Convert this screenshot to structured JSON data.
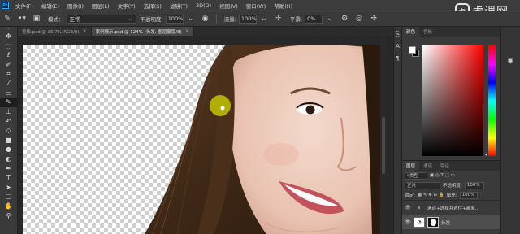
{
  "menubar": {
    "app_logo": "Ps",
    "items": [
      "文件(F)",
      "编辑(E)",
      "图像(I)",
      "图层(L)",
      "文字(Y)",
      "选择(S)",
      "滤镜(T)",
      "3D(D)",
      "视图(V)",
      "窗口(W)",
      "帮助(H)"
    ],
    "watermark": "虎课网"
  },
  "options": {
    "mode_label": "模式：",
    "mode_value": "正常",
    "opacity_label": "不透明度:",
    "opacity_value": "100%",
    "flow_label": "流量:",
    "flow_value": "100%",
    "smoothing_label": "平滑:",
    "smoothing_value": "0%"
  },
  "tabs": [
    {
      "title": "抠像.psd @ 36.7%(RGB/8)",
      "active": false
    },
    {
      "title": "案例展示.psd @ 124% (头发, 图层蒙版/8)",
      "active": true
    }
  ],
  "color_panel": {
    "tabs": [
      "颜色",
      "色板"
    ],
    "colors": {
      "foreground": "#ffffff",
      "background": "#000000"
    }
  },
  "layers_panel": {
    "tabs": [
      "图层",
      "通道",
      "路径"
    ],
    "filter_value": "类型",
    "blend_mode": "正常",
    "opacity_label": "不透明度:",
    "opacity_value": "100%",
    "lock_label": "锁定:",
    "fill_label": "填充:",
    "fill_value": "100%",
    "layers": [
      {
        "name": "通道+选择并遮住+画笔...",
        "type": "text"
      },
      {
        "name": "头发",
        "type": "image-with-mask"
      }
    ]
  },
  "tools": [
    "move-tool-icon",
    "marquee-tool-icon",
    "lasso-tool-icon",
    "quick-select-tool-icon",
    "crop-tool-icon",
    "eyedropper-tool-icon",
    "healing-tool-icon",
    "brush-tool-icon",
    "stamp-tool-icon",
    "history-brush-tool-icon",
    "eraser-tool-icon",
    "gradient-tool-icon",
    "blur-tool-icon",
    "dodge-tool-icon",
    "pen-tool-icon",
    "type-tool-icon",
    "path-select-tool-icon",
    "rectangle-tool-icon",
    "hand-tool-icon",
    "zoom-tool-icon"
  ]
}
